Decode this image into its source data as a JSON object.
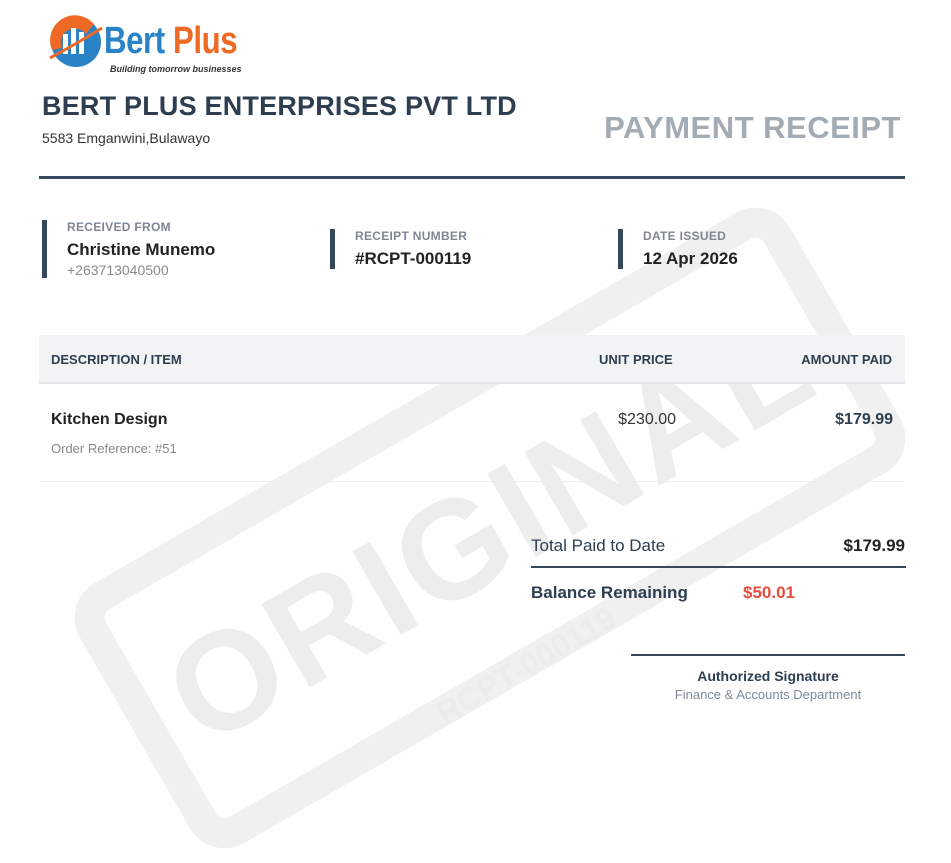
{
  "watermark": {
    "text": "ORIGINAL",
    "sub": "RCPT-000119"
  },
  "logo": {
    "word1": "Bert",
    "word2": "Plus",
    "tagline": "Building tomorrow businesses",
    "color1": "#2a82c7",
    "color2": "#ee6a24"
  },
  "company": {
    "name": "BERT PLUS ENTERPRISES PVT LTD",
    "address": "5583 Emganwini,Bulawayo"
  },
  "document_title": "PAYMENT RECEIPT",
  "info": {
    "received_from": {
      "label": "RECEIVED FROM",
      "name": "Christine Munemo",
      "phone": "+263713040500"
    },
    "receipt_number": {
      "label": "RECEIPT NUMBER",
      "value": "#RCPT-000119"
    },
    "date_issued": {
      "label": "DATE ISSUED",
      "value": "12 Apr 2026"
    }
  },
  "table": {
    "headers": {
      "description": "DESCRIPTION / ITEM",
      "unit_price": "UNIT PRICE",
      "amount_paid": "AMOUNT PAID"
    },
    "rows": [
      {
        "description": "Kitchen Design",
        "reference": "Order Reference: #51",
        "unit_price": "$230.00",
        "amount_paid": "$179.99"
      }
    ]
  },
  "totals": {
    "total_paid_label": "Total Paid to Date",
    "total_paid_value": "$179.99",
    "balance_label": "Balance Remaining",
    "balance_value": "$50.01"
  },
  "signature": {
    "title": "Authorized Signature",
    "department": "Finance & Accounts Department"
  },
  "colors": {
    "primary": "#34495e",
    "heading": "#2c3e50",
    "muted_title": "#a3abb5",
    "balance": "#e74c3c"
  }
}
